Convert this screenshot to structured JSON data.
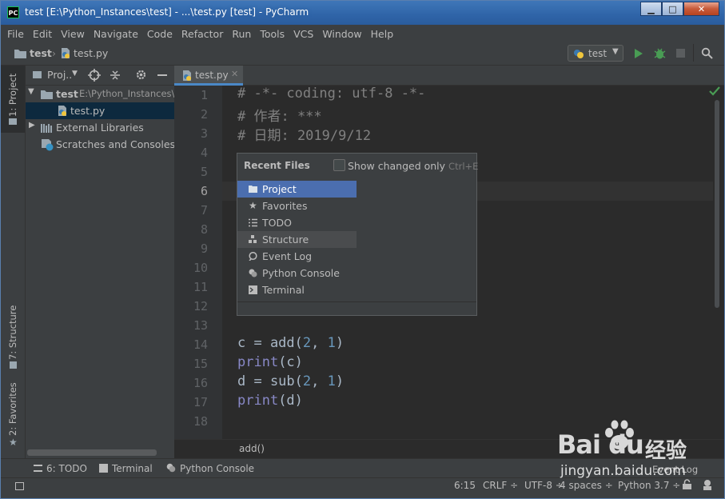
{
  "window": {
    "title": "test [E:\\Python_Instances\\test] - ...\\test.py [test] - PyCharm",
    "logo": "PC"
  },
  "menu": [
    "File",
    "Edit",
    "View",
    "Navigate",
    "Code",
    "Refactor",
    "Run",
    "Tools",
    "VCS",
    "Window",
    "Help"
  ],
  "navbar": {
    "crumbs": [
      "test",
      "test.py"
    ],
    "run_config": "test"
  },
  "left_stripe": {
    "project": "1: Project",
    "structure": "7: Structure",
    "favorites": "2: Favorites"
  },
  "project_panel": {
    "selector": "Proj..",
    "tree": [
      {
        "name": "test",
        "path": "E:\\Python_Instances\\"
      },
      {
        "name": "test.py"
      },
      {
        "name": "External Libraries"
      },
      {
        "name": "Scratches and Consoles"
      }
    ]
  },
  "editor": {
    "tab_label": "test.py",
    "current_line": 6,
    "line_numbers": [
      "1",
      "2",
      "3",
      "4",
      "5",
      "6",
      "7",
      "8",
      "9",
      "10",
      "11",
      "12",
      "13",
      "14",
      "15",
      "16",
      "17",
      "18"
    ],
    "code": {
      "l1": "# -*- coding: utf-8 -*-",
      "l2": "# 作者: ***",
      "l3": "# 日期: 2019/9/12",
      "l14_a": "c = add(",
      "l14_n1": "2",
      "l14_c": ", ",
      "l14_n2": "1",
      "l14_e": ")",
      "l15_f": "print",
      "l15_r": "(c)",
      "l16_a": "d = sub(",
      "l16_n1": "2",
      "l16_c": ", ",
      "l16_n2": "1",
      "l16_e": ")",
      "l17_f": "print",
      "l17_r": "(d)"
    },
    "breadcrumb": "add()"
  },
  "popup": {
    "title": "Recent Files",
    "checkbox_label": "Show changed only",
    "shortcut": "Ctrl+E",
    "items": [
      {
        "label": "Project",
        "icon": "folder-icon"
      },
      {
        "label": "Favorites",
        "icon": "star-icon"
      },
      {
        "label": "TODO",
        "icon": "list-icon"
      },
      {
        "label": "Structure",
        "icon": "structure-icon"
      },
      {
        "label": "Event Log",
        "icon": "event-log-icon"
      },
      {
        "label": "Python Console",
        "icon": "python-icon"
      },
      {
        "label": "Terminal",
        "icon": "terminal-icon"
      }
    ]
  },
  "bottom_tools": {
    "todo": "6: TODO",
    "terminal": "Terminal",
    "python_console": "Python Console",
    "event_log": "Event Log"
  },
  "status": {
    "position": "6:15",
    "line_sep": "CRLF ÷",
    "encoding": "UTF-8 ÷",
    "indent": "4 spaces ÷",
    "interpreter": "Python 3.7 ÷"
  },
  "watermark": {
    "brand": "Bai du",
    "cn": "经验",
    "url": "jingyan.baidu.com"
  },
  "colors": {
    "accent_blue": "#4b6eaf",
    "run_green": "#499c54",
    "editor_bg": "#2b2b2b",
    "panel_bg": "#3c3f41"
  }
}
